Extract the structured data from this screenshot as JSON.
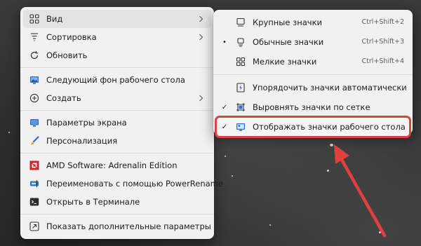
{
  "main_menu": {
    "items": [
      {
        "label": "Вид",
        "icon": "grid-icon"
      },
      {
        "label": "Сортировка",
        "icon": "sort-icon"
      },
      {
        "label": "Обновить",
        "icon": "refresh-icon"
      },
      {
        "label": "Следующий фон рабочего стола",
        "icon": "wallpaper-icon"
      },
      {
        "label": "Создать",
        "icon": "new-icon"
      },
      {
        "label": "Параметры экрана",
        "icon": "display-icon"
      },
      {
        "label": "Персонализация",
        "icon": "brush-icon"
      },
      {
        "label": "AMD Software: Adrenalin Edition",
        "icon": "amd-icon"
      },
      {
        "label": "Переименовать с помощью PowerRename",
        "icon": "powerrename-icon"
      },
      {
        "label": "Открыть в Терминале",
        "icon": "terminal-icon"
      },
      {
        "label": "Показать дополнительные параметры",
        "icon": "more-options-icon"
      }
    ]
  },
  "view_submenu": {
    "items": [
      {
        "label": "Крупные значки",
        "shortcut": "Ctrl+Shift+2",
        "icon": "large-icons-icon",
        "mark": ""
      },
      {
        "label": "Обычные значки",
        "shortcut": "Ctrl+Shift+3",
        "icon": "medium-icons-icon",
        "mark": "•"
      },
      {
        "label": "Мелкие значки",
        "shortcut": "Ctrl+Shift+4",
        "icon": "small-icons-icon",
        "mark": ""
      },
      {
        "label": "Упорядочить значки автоматически",
        "shortcut": "",
        "icon": "auto-arrange-icon",
        "mark": ""
      },
      {
        "label": "Выровнять значки по сетке",
        "shortcut": "",
        "icon": "align-grid-icon",
        "mark": "✓"
      },
      {
        "label": "Отображать значки рабочего стола",
        "shortcut": "",
        "icon": "show-desktop-icons-icon",
        "mark": "✓"
      }
    ]
  },
  "colors": {
    "menu_bg": "#f2f1f1",
    "highlight_outline": "#e0413d",
    "arrow": "#e0413d",
    "accent_blue": "#2a6fd6",
    "amd_red": "#d2232a"
  }
}
